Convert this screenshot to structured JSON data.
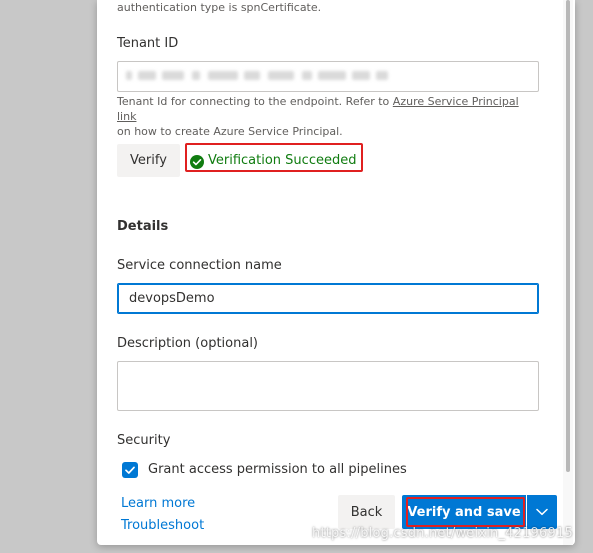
{
  "auth_note": "authentication type is spnCertificate.",
  "tenant": {
    "label": "Tenant ID",
    "help_prefix": "Tenant Id for connecting to the endpoint. Refer to ",
    "help_link": "Azure Service Principal link",
    "help_suffix": "on how to create Azure Service Principal."
  },
  "verify": {
    "button_label": "Verify",
    "status_text": "Verification Succeeded",
    "status_color": "#107c10"
  },
  "details": {
    "heading": "Details",
    "service_connection_label": "Service connection name",
    "service_connection_value": "devopsDemo",
    "description_label": "Description (optional)",
    "description_value": ""
  },
  "security": {
    "heading": "Security",
    "grant_access_label": "Grant access permission to all pipelines",
    "grant_access_checked": true
  },
  "footer": {
    "learn_more": "Learn more",
    "troubleshoot": "Troubleshoot",
    "back_label": "Back",
    "verify_and_save_label": "Verify and save"
  },
  "watermark": "https://blog.csdn.net/weixin_42196915",
  "colors": {
    "primary": "#0078d4",
    "highlight_box": "#e02020",
    "success": "#107c10",
    "link": "#0078d4"
  }
}
